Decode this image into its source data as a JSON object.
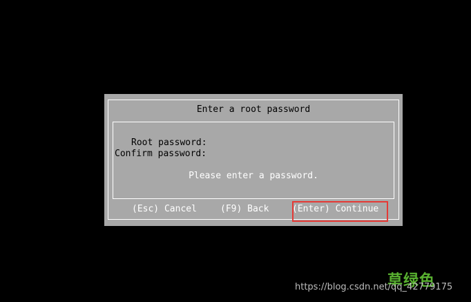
{
  "dialog": {
    "title": "Enter a root password",
    "fields": {
      "root_label": "Root password:",
      "root_value": "",
      "confirm_label": "Confirm password:",
      "confirm_value": ""
    },
    "message": "Please enter a password.",
    "actions": {
      "cancel": "(Esc) Cancel",
      "back": "(F9) Back",
      "continue": "(Enter) Continue"
    }
  },
  "watermark": {
    "logo": "草绿色",
    "url": "https://blog.csdn.net/qq_42779175"
  },
  "colors": {
    "background": "#000000",
    "dialog": "#a8a8a8",
    "highlight": "#e53935"
  }
}
